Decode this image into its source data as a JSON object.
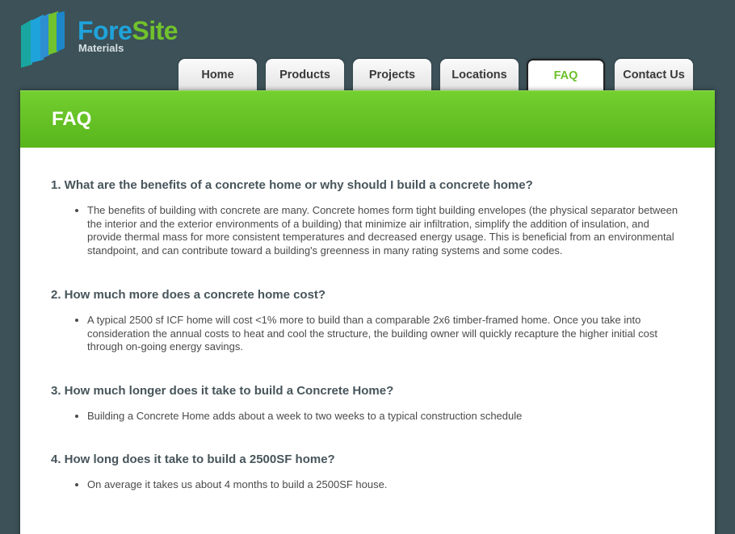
{
  "brand": {
    "name_part1": "Fore",
    "name_part2": "Site",
    "subtitle": "Materials",
    "colors": {
      "blue": "#1fa3db",
      "green": "#71c22c",
      "teal": "#1aa6a0"
    }
  },
  "nav": {
    "tabs": [
      {
        "label": "Home",
        "active": false
      },
      {
        "label": "Products",
        "active": false
      },
      {
        "label": "Projects",
        "active": false
      },
      {
        "label": "Locations",
        "active": false
      },
      {
        "label": "FAQ",
        "active": true
      },
      {
        "label": "Contact Us",
        "active": false
      }
    ]
  },
  "page": {
    "title": "FAQ",
    "accent_color": "#6cc12a"
  },
  "faq": [
    {
      "question": "1. What are the benefits of a concrete home or why should I build a concrete home?",
      "answers": [
        "The benefits of building with concrete are many. Concrete homes form tight building envelopes (the physical separator between the interior and the exterior environments of a building) that minimize air infiltration, simplify the addition of insulation, and provide thermal mass for more consistent temperatures and decreased energy usage. This is beneficial from an environmental standpoint, and can contribute toward a building's greenness in many rating systems and some codes."
      ]
    },
    {
      "question": "2. How much more does a concrete home cost?",
      "answers": [
        "A typical 2500 sf ICF home will cost <1% more to build than a comparable 2x6 timber-framed home. Once you take into consideration the annual costs to heat and cool the structure, the building owner will quickly recapture the higher initial cost through on-going energy savings."
      ]
    },
    {
      "question": "3. How much longer does it take to build a Concrete Home?",
      "answers": [
        "Building a Concrete Home adds about a week to two weeks to a typical construction schedule"
      ]
    },
    {
      "question": "4. How long does it take to build a 2500SF home?",
      "answers": [
        "On average it takes us about 4 months to build a 2500SF house."
      ]
    }
  ]
}
